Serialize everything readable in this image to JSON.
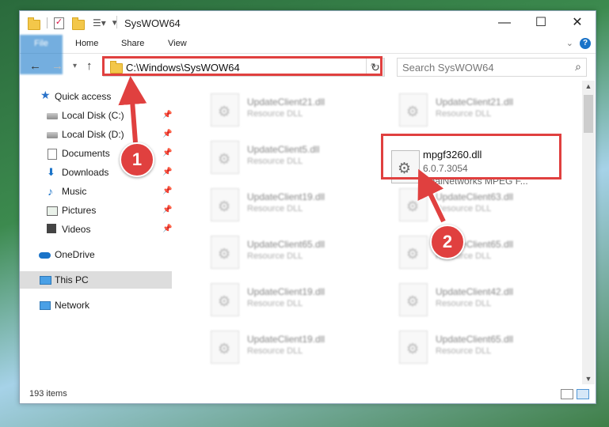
{
  "window": {
    "title": "SysWOW64"
  },
  "ribbon": {
    "tabs": [
      "File",
      "Home",
      "Share",
      "View"
    ]
  },
  "address": {
    "path": "C:\\Windows\\SysWOW64",
    "search_placeholder": "Search SysWOW64"
  },
  "sidebar": {
    "items": [
      {
        "label": "Quick access",
        "icon": "star-icon"
      },
      {
        "label": "Local Disk (C:)",
        "icon": "drive-icon"
      },
      {
        "label": "Local Disk (D:)",
        "icon": "drive-icon"
      },
      {
        "label": "Documents",
        "icon": "documents-icon"
      },
      {
        "label": "Downloads",
        "icon": "download-icon"
      },
      {
        "label": "Music",
        "icon": "music-icon"
      },
      {
        "label": "Pictures",
        "icon": "pictures-icon"
      },
      {
        "label": "Videos",
        "icon": "videos-icon"
      },
      {
        "label": "OneDrive",
        "icon": "onedrive-icon"
      },
      {
        "label": "This PC",
        "icon": "pc-icon"
      },
      {
        "label": "Network",
        "icon": "network-icon"
      }
    ]
  },
  "files": [
    {
      "name": "UpdateClient21.dll",
      "desc": "Resource DLL"
    },
    {
      "name": "UpdateClient21.dll",
      "desc": "Resource DLL"
    },
    {
      "name": "UpdateClient5.dll",
      "desc": "Resource DLL"
    },
    {
      "name": "UpdateClient19.dll",
      "desc": "Resource DLL"
    },
    {
      "name": "UpdateClient63.dll",
      "desc": "Resource DLL"
    },
    {
      "name": "UpdateClient65.dll",
      "desc": "Resource DLL"
    },
    {
      "name": "UpdateClient65.dll",
      "desc": "Resource DLL"
    },
    {
      "name": "UpdateClient19.dll",
      "desc": "Resource DLL"
    },
    {
      "name": "UpdateClient42.dll",
      "desc": "Resource DLL"
    },
    {
      "name": "UpdateClient19.dll",
      "desc": "Resource DLL"
    },
    {
      "name": "UpdateClient65.dll",
      "desc": "Resource DLL"
    }
  ],
  "target_file": {
    "name": "mpgf3260.dll",
    "version": "6.0.7.3054",
    "desc": "RealNetworks MPEG F..."
  },
  "status": {
    "items": "193 items"
  },
  "callouts": {
    "one": "1",
    "two": "2"
  },
  "colors": {
    "accent": "#1979ca",
    "highlight": "#e0403f"
  }
}
